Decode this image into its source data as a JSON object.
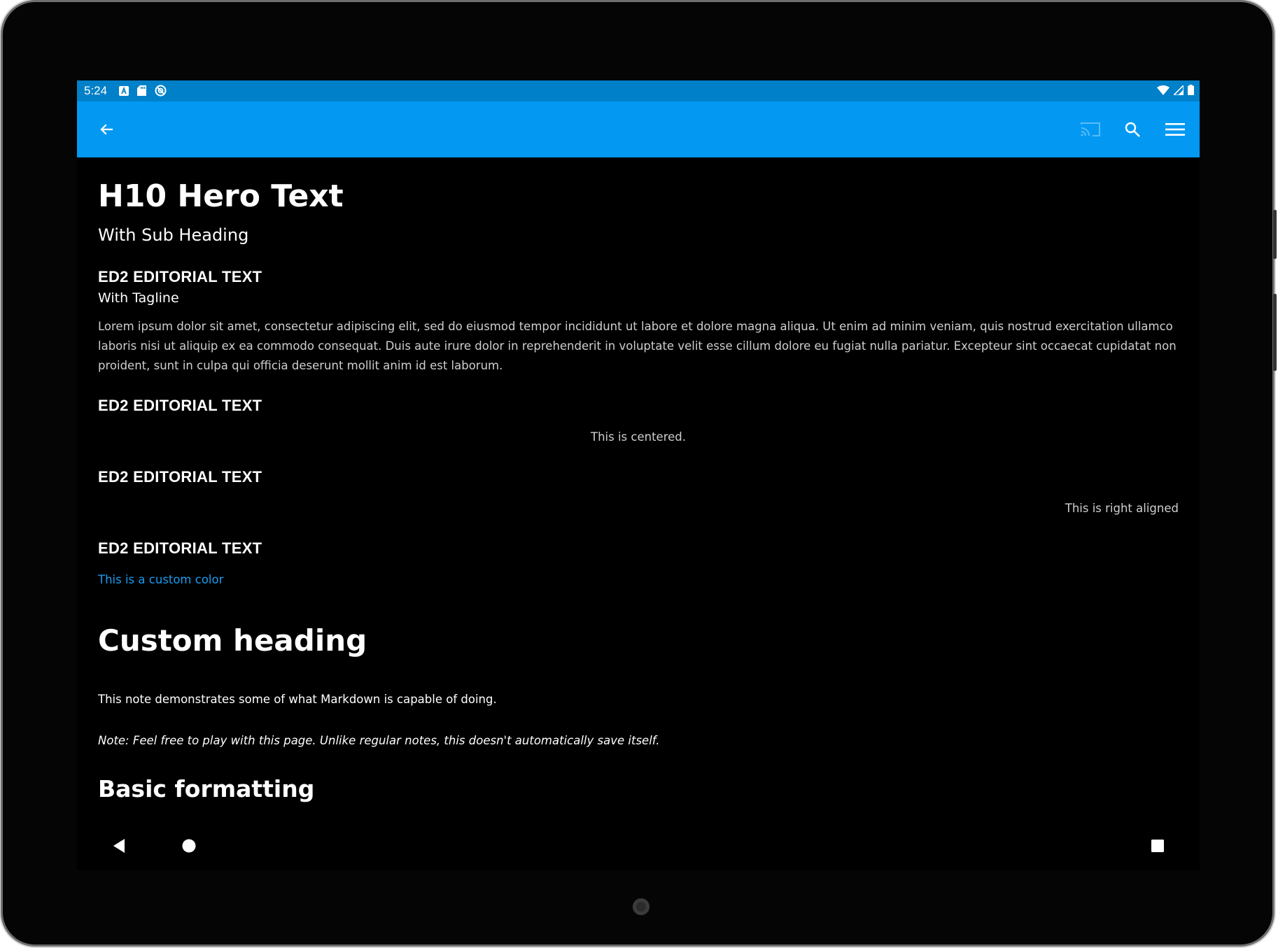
{
  "status_bar": {
    "time": "5:24"
  },
  "app_bar": {
    "back_icon": "arrow-left-icon",
    "actions": [
      "cast-icon",
      "search-icon",
      "menu-icon"
    ]
  },
  "content": {
    "hero_title": "H10 Hero Text",
    "hero_subheading": "With Sub Heading",
    "editorial_1": {
      "title": "ED2 EDITORIAL TEXT",
      "tagline": "With Tagline",
      "body": "Lorem ipsum dolor sit amet, consectetur adipiscing elit, sed do eiusmod tempor incididunt ut labore et dolore magna aliqua. Ut enim ad minim veniam, quis nostrud exercitation ullamco laboris nisi ut aliquip ex ea commodo consequat. Duis aute irure dolor in reprehenderit in voluptate velit esse cillum dolore eu fugiat nulla pariatur. Excepteur sint occaecat cupidatat non proident, sunt in culpa qui officia deserunt mollit anim id est laborum."
    },
    "editorial_2": {
      "title": "ED2 EDITORIAL TEXT",
      "text": "This is centered."
    },
    "editorial_3": {
      "title": "ED2 EDITORIAL TEXT",
      "text": "This is right aligned"
    },
    "editorial_4": {
      "title": "ED2 EDITORIAL TEXT",
      "text": "This is a custom color",
      "text_color": "#1a9cf0"
    },
    "custom_heading": "Custom heading",
    "note_1": "This note demonstrates some of what Markdown is capable of doing.",
    "note_2": "Note: Feel free to play with this page. Unlike regular notes, this doesn't automatically save itself.",
    "basic_formatting_heading": "Basic formatting"
  },
  "colors": {
    "status_bar": "#0080c8",
    "app_bar": "#0399f3",
    "background": "#000000"
  }
}
